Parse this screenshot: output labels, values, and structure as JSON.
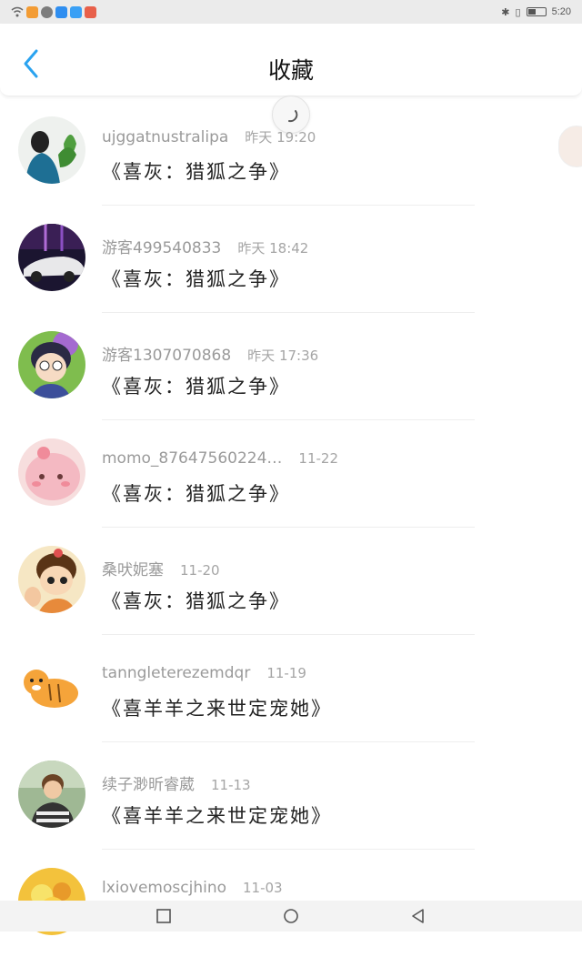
{
  "status_bar": {
    "time": "5:20"
  },
  "header": {
    "title": "收藏",
    "back_icon": "chevron-left-icon",
    "accent": "#2aa3f0"
  },
  "favorites": [
    {
      "user": "ujggatnustralipa",
      "time": "昨天 19:20",
      "work": "《喜灰：猎狐之争》"
    },
    {
      "user": "游客499540833",
      "time": "昨天 18:42",
      "work": "《喜灰：猎狐之争》"
    },
    {
      "user": "游客1307070868",
      "time": "昨天 17:36",
      "work": "《喜灰：猎狐之争》"
    },
    {
      "user": "momo_87647560224…",
      "time": "11-22",
      "work": "《喜灰：猎狐之争》"
    },
    {
      "user": "桑吠妮塞",
      "time": "11-20",
      "work": "《喜灰：猎狐之争》"
    },
    {
      "user": "tanngleterezemdqr",
      "time": "11-19",
      "work": "《喜羊羊之来世定宠她》"
    },
    {
      "user": "续子渺昕睿葳",
      "time": "11-13",
      "work": "《喜羊羊之来世定宠她》"
    },
    {
      "user": "lxiovemoscjhino",
      "time": "11-03",
      "work": ""
    }
  ],
  "nav_icons": [
    "recent-apps-icon",
    "home-icon",
    "back-triangle-icon"
  ]
}
